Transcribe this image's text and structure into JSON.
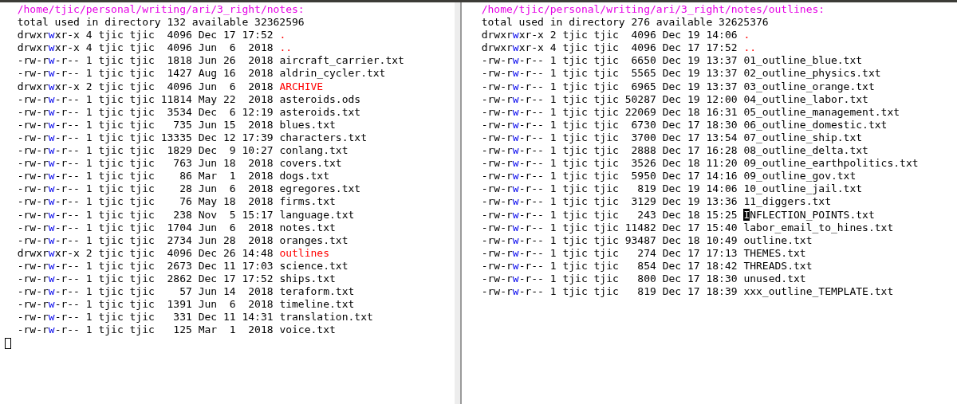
{
  "panes": [
    {
      "header": "/home/tjic/personal/writing/ari/3_right/notes:",
      "summary": "total used in directory 132 available 32362596",
      "trailing_cursor": true,
      "rows": [
        {
          "kind": "dir",
          "perms": "drwxrwxr-x",
          "links": "4",
          "owner": "tjic",
          "group": "tjic",
          "size": "4096",
          "date": "Dec 17 17:52",
          "name": ".",
          "cursor": false
        },
        {
          "kind": "dir",
          "perms": "drwxrwxr-x",
          "links": "4",
          "owner": "tjic",
          "group": "tjic",
          "size": "4096",
          "date": "Jun  6  2018",
          "name": "..",
          "cursor": false
        },
        {
          "kind": "file",
          "perms": "-rw-rw-r--",
          "links": "1",
          "owner": "tjic",
          "group": "tjic",
          "size": "1818",
          "date": "Jun 26  2018",
          "name": "aircraft_carrier.txt",
          "cursor": false
        },
        {
          "kind": "file",
          "perms": "-rw-rw-r--",
          "links": "1",
          "owner": "tjic",
          "group": "tjic",
          "size": "1427",
          "date": "Aug 16  2018",
          "name": "aldrin_cycler.txt",
          "cursor": false
        },
        {
          "kind": "dir",
          "perms": "drwxrwxr-x",
          "links": "2",
          "owner": "tjic",
          "group": "tjic",
          "size": "4096",
          "date": "Jun  6  2018",
          "name": "ARCHIVE",
          "cursor": false
        },
        {
          "kind": "file",
          "perms": "-rw-rw-r--",
          "links": "1",
          "owner": "tjic",
          "group": "tjic",
          "size": "11814",
          "date": "May 22  2018",
          "name": "asteroids.ods",
          "cursor": false
        },
        {
          "kind": "file",
          "perms": "-rw-rw-r--",
          "links": "1",
          "owner": "tjic",
          "group": "tjic",
          "size": "3534",
          "date": "Dec  6 12:19",
          "name": "asteroids.txt",
          "cursor": false
        },
        {
          "kind": "file",
          "perms": "-rw-rw-r--",
          "links": "1",
          "owner": "tjic",
          "group": "tjic",
          "size": "735",
          "date": "Jun 15  2018",
          "name": "blues.txt",
          "cursor": false
        },
        {
          "kind": "file",
          "perms": "-rw-rw-r--",
          "links": "1",
          "owner": "tjic",
          "group": "tjic",
          "size": "13335",
          "date": "Dec 12 17:39",
          "name": "characters.txt",
          "cursor": false
        },
        {
          "kind": "file",
          "perms": "-rw-rw-r--",
          "links": "1",
          "owner": "tjic",
          "group": "tjic",
          "size": "1829",
          "date": "Dec  9 10:27",
          "name": "conlang.txt",
          "cursor": false
        },
        {
          "kind": "file",
          "perms": "-rw-rw-r--",
          "links": "1",
          "owner": "tjic",
          "group": "tjic",
          "size": "763",
          "date": "Jun 18  2018",
          "name": "covers.txt",
          "cursor": false
        },
        {
          "kind": "file",
          "perms": "-rw-rw-r--",
          "links": "1",
          "owner": "tjic",
          "group": "tjic",
          "size": "86",
          "date": "Mar  1  2018",
          "name": "dogs.txt",
          "cursor": false
        },
        {
          "kind": "file",
          "perms": "-rw-rw-r--",
          "links": "1",
          "owner": "tjic",
          "group": "tjic",
          "size": "28",
          "date": "Jun  6  2018",
          "name": "egregores.txt",
          "cursor": false
        },
        {
          "kind": "file",
          "perms": "-rw-rw-r--",
          "links": "1",
          "owner": "tjic",
          "group": "tjic",
          "size": "76",
          "date": "May 18  2018",
          "name": "firms.txt",
          "cursor": false
        },
        {
          "kind": "file",
          "perms": "-rw-rw-r--",
          "links": "1",
          "owner": "tjic",
          "group": "tjic",
          "size": "238",
          "date": "Nov  5 15:17",
          "name": "language.txt",
          "cursor": false
        },
        {
          "kind": "file",
          "perms": "-rw-rw-r--",
          "links": "1",
          "owner": "tjic",
          "group": "tjic",
          "size": "1704",
          "date": "Jun  6  2018",
          "name": "notes.txt",
          "cursor": false
        },
        {
          "kind": "file",
          "perms": "-rw-rw-r--",
          "links": "1",
          "owner": "tjic",
          "group": "tjic",
          "size": "2734",
          "date": "Jun 28  2018",
          "name": "oranges.txt",
          "cursor": false
        },
        {
          "kind": "dir",
          "perms": "drwxrwxr-x",
          "links": "2",
          "owner": "tjic",
          "group": "tjic",
          "size": "4096",
          "date": "Dec 26 14:48",
          "name": "outlines",
          "cursor": false
        },
        {
          "kind": "file",
          "perms": "-rw-rw-r--",
          "links": "1",
          "owner": "tjic",
          "group": "tjic",
          "size": "2673",
          "date": "Dec 11 17:03",
          "name": "science.txt",
          "cursor": false
        },
        {
          "kind": "file",
          "perms": "-rw-rw-r--",
          "links": "1",
          "owner": "tjic",
          "group": "tjic",
          "size": "2862",
          "date": "Dec 17 17:52",
          "name": "ships.txt",
          "cursor": false
        },
        {
          "kind": "file",
          "perms": "-rw-rw-r--",
          "links": "1",
          "owner": "tjic",
          "group": "tjic",
          "size": "57",
          "date": "Jun 14  2018",
          "name": "teraform.txt",
          "cursor": false
        },
        {
          "kind": "file",
          "perms": "-rw-rw-r--",
          "links": "1",
          "owner": "tjic",
          "group": "tjic",
          "size": "1391",
          "date": "Jun  6  2018",
          "name": "timeline.txt",
          "cursor": false
        },
        {
          "kind": "file",
          "perms": "-rw-rw-r--",
          "links": "1",
          "owner": "tjic",
          "group": "tjic",
          "size": "331",
          "date": "Dec 11 14:31",
          "name": "translation.txt",
          "cursor": false
        },
        {
          "kind": "file",
          "perms": "-rw-rw-r--",
          "links": "1",
          "owner": "tjic",
          "group": "tjic",
          "size": "125",
          "date": "Mar  1  2018",
          "name": "voice.txt",
          "cursor": false
        }
      ]
    },
    {
      "header": "/home/tjic/personal/writing/ari/3_right/notes/outlines:",
      "summary": "total used in directory 276 available 32625376",
      "rows": [
        {
          "kind": "dir",
          "perms": "drwxrwxr-x",
          "links": "2",
          "owner": "tjic",
          "group": "tjic",
          "size": "4096",
          "date": "Dec 19 14:06",
          "name": ".",
          "cursor": false
        },
        {
          "kind": "dir",
          "perms": "drwxrwxr-x",
          "links": "4",
          "owner": "tjic",
          "group": "tjic",
          "size": "4096",
          "date": "Dec 17 17:52",
          "name": "..",
          "cursor": false
        },
        {
          "kind": "file",
          "perms": "-rw-rw-r--",
          "links": "1",
          "owner": "tjic",
          "group": "tjic",
          "size": "6650",
          "date": "Dec 19 13:37",
          "name": "01_outline_blue.txt",
          "cursor": false
        },
        {
          "kind": "file",
          "perms": "-rw-rw-r--",
          "links": "1",
          "owner": "tjic",
          "group": "tjic",
          "size": "5565",
          "date": "Dec 19 13:37",
          "name": "02_outline_physics.txt",
          "cursor": false
        },
        {
          "kind": "file",
          "perms": "-rw-rw-r--",
          "links": "1",
          "owner": "tjic",
          "group": "tjic",
          "size": "6965",
          "date": "Dec 19 13:37",
          "name": "03_outline_orange.txt",
          "cursor": false
        },
        {
          "kind": "file",
          "perms": "-rw-rw-r--",
          "links": "1",
          "owner": "tjic",
          "group": "tjic",
          "size": "50287",
          "date": "Dec 19 12:00",
          "name": "04_outline_labor.txt",
          "cursor": false
        },
        {
          "kind": "file",
          "perms": "-rw-rw-r--",
          "links": "1",
          "owner": "tjic",
          "group": "tjic",
          "size": "22069",
          "date": "Dec 18 16:31",
          "name": "05_outline_management.txt",
          "cursor": false
        },
        {
          "kind": "file",
          "perms": "-rw-rw-r--",
          "links": "1",
          "owner": "tjic",
          "group": "tjic",
          "size": "6730",
          "date": "Dec 17 18:30",
          "name": "06_outline_domestic.txt",
          "cursor": false
        },
        {
          "kind": "file",
          "perms": "-rw-rw-r--",
          "links": "1",
          "owner": "tjic",
          "group": "tjic",
          "size": "3700",
          "date": "Dec 17 13:54",
          "name": "07_outline_ship.txt",
          "cursor": false
        },
        {
          "kind": "file",
          "perms": "-rw-rw-r--",
          "links": "1",
          "owner": "tjic",
          "group": "tjic",
          "size": "2888",
          "date": "Dec 17 16:28",
          "name": "08_outline_delta.txt",
          "cursor": false
        },
        {
          "kind": "file",
          "perms": "-rw-rw-r--",
          "links": "1",
          "owner": "tjic",
          "group": "tjic",
          "size": "3526",
          "date": "Dec 18 11:20",
          "name": "09_outline_earthpolitics.txt",
          "cursor": false
        },
        {
          "kind": "file",
          "perms": "-rw-rw-r--",
          "links": "1",
          "owner": "tjic",
          "group": "tjic",
          "size": "5950",
          "date": "Dec 17 14:16",
          "name": "09_outline_gov.txt",
          "cursor": false
        },
        {
          "kind": "file",
          "perms": "-rw-rw-r--",
          "links": "1",
          "owner": "tjic",
          "group": "tjic",
          "size": "819",
          "date": "Dec 19 14:06",
          "name": "10_outline_jail.txt",
          "cursor": false
        },
        {
          "kind": "file",
          "perms": "-rw-rw-r--",
          "links": "1",
          "owner": "tjic",
          "group": "tjic",
          "size": "3129",
          "date": "Dec 19 13:36",
          "name": "11_diggers.txt",
          "cursor": false
        },
        {
          "kind": "file",
          "perms": "-rw-rw-r--",
          "links": "1",
          "owner": "tjic",
          "group": "tjic",
          "size": "243",
          "date": "Dec 18 15:25",
          "name": "INFLECTION_POINTS.txt",
          "cursor": true
        },
        {
          "kind": "file",
          "perms": "-rw-rw-r--",
          "links": "1",
          "owner": "tjic",
          "group": "tjic",
          "size": "11482",
          "date": "Dec 17 15:40",
          "name": "labor_email_to_hines.txt",
          "cursor": false
        },
        {
          "kind": "file",
          "perms": "-rw-rw-r--",
          "links": "1",
          "owner": "tjic",
          "group": "tjic",
          "size": "93487",
          "date": "Dec 18 10:49",
          "name": "outline.txt",
          "cursor": false
        },
        {
          "kind": "file",
          "perms": "-rw-rw-r--",
          "links": "1",
          "owner": "tjic",
          "group": "tjic",
          "size": "274",
          "date": "Dec 17 17:13",
          "name": "THEMES.txt",
          "cursor": false
        },
        {
          "kind": "file",
          "perms": "-rw-rw-r--",
          "links": "1",
          "owner": "tjic",
          "group": "tjic",
          "size": "854",
          "date": "Dec 17 18:42",
          "name": "THREADS.txt",
          "cursor": false
        },
        {
          "kind": "file",
          "perms": "-rw-rw-r--",
          "links": "1",
          "owner": "tjic",
          "group": "tjic",
          "size": "800",
          "date": "Dec 17 18:30",
          "name": "unused.txt",
          "cursor": false
        },
        {
          "kind": "file",
          "perms": "-rw-rw-r--",
          "links": "1",
          "owner": "tjic",
          "group": "tjic",
          "size": "819",
          "date": "Dec 17 18:39",
          "name": "xxx_outline_TEMPLATE.txt",
          "cursor": false
        }
      ]
    }
  ]
}
